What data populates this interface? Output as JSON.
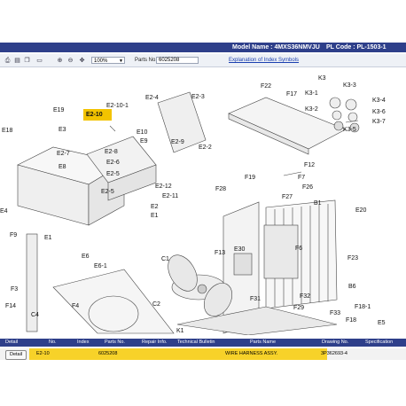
{
  "header": {
    "model": "Model Name : 4MXS36NMVJU",
    "plcode": "PL Code : PL-1503-1"
  },
  "toolbar": {
    "icons": [
      "print-icon",
      "save-icon",
      "copy-icon",
      "page-icon",
      "zoom-in-icon",
      "zoom-out-icon",
      "pan-icon"
    ],
    "zoom": "100%",
    "parts_label": "Parts No.",
    "parts_value": "6025208",
    "index_link": "Explanation of Index Symbols"
  },
  "diagram": {
    "labels": [
      "F22",
      "F17",
      "K3",
      "K3-3",
      "K3-1",
      "K3-2",
      "K3-4",
      "K3-6",
      "K3-7",
      "K3-5",
      "E19",
      "E2-10",
      "E2-10-1",
      "E2-4",
      "E2-3",
      "E18",
      "E3",
      "E10",
      "E9",
      "E2-9",
      "E2-2",
      "E2-8",
      "E2-6",
      "E2-5",
      "E2-7",
      "E8",
      "E2-5",
      "E2-12",
      "E2-11",
      "E2",
      "E1",
      "F12",
      "F7",
      "F26",
      "F28",
      "F19",
      "F27",
      "B1",
      "E4",
      "F9",
      "E1",
      "E6",
      "E6-1",
      "E20",
      "F6",
      "F23",
      "C1",
      "F13",
      "E30",
      "F3",
      "F4",
      "C2",
      "F32",
      "F31",
      "B6",
      "F14",
      "C4",
      "F29",
      "F33",
      "F18-1",
      "F18",
      "E5",
      "K1"
    ],
    "highlight": "E2-10"
  },
  "table": {
    "headers": [
      "Detail",
      "No.",
      "Index",
      "Parts No.",
      "Repair Info.",
      "Technical Bulletin",
      "Parts Name",
      "Drawing No.",
      "Specification"
    ],
    "row": {
      "detail": "Detail",
      "no": "E2-10",
      "index": "",
      "parts_no": "6025208",
      "repair_info": "",
      "technical_bulletin": "",
      "parts_name": "WIRE HARNESS ASSY.",
      "drawing_no": "3P362693-4",
      "specification": ""
    }
  }
}
